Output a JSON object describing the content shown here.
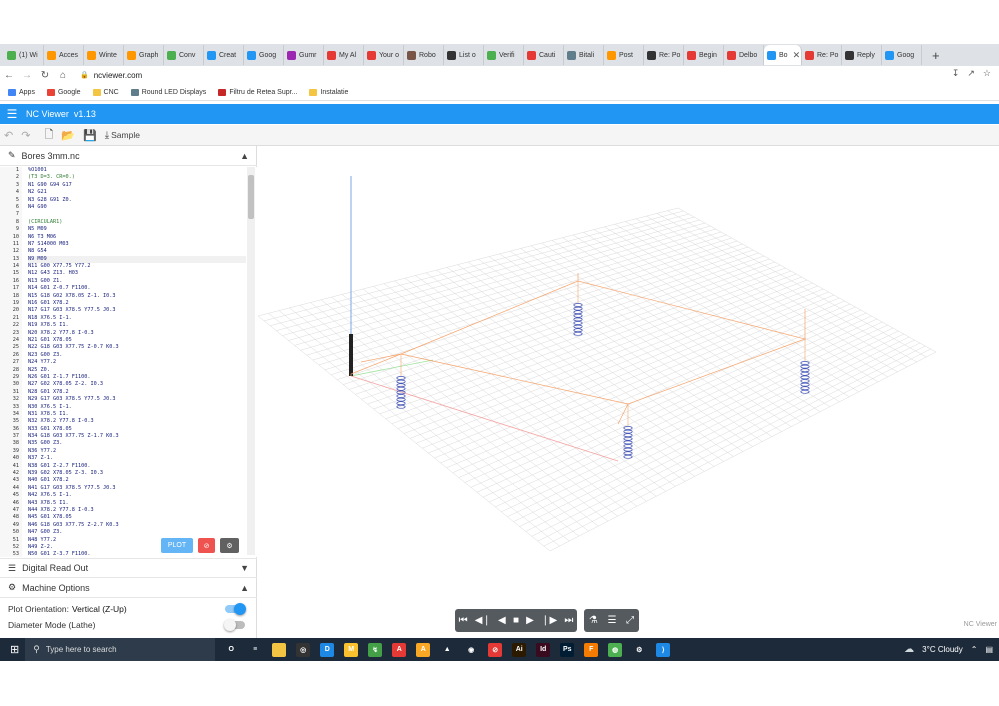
{
  "browser": {
    "tabs": [
      {
        "label": "(1) Wi",
        "color": "#4caf50"
      },
      {
        "label": "Acces",
        "color": "#ff9800"
      },
      {
        "label": "Winte",
        "color": "#ff9800"
      },
      {
        "label": "Graph",
        "color": "#ff9800"
      },
      {
        "label": "Conv",
        "color": "#4caf50"
      },
      {
        "label": "Creat",
        "color": "#2196f3"
      },
      {
        "label": "Goog",
        "color": "#2196f3"
      },
      {
        "label": "Gumr",
        "color": "#9c27b0"
      },
      {
        "label": "My Al",
        "color": "#e53935"
      },
      {
        "label": "Your o",
        "color": "#e53935"
      },
      {
        "label": "Robo",
        "color": "#795548"
      },
      {
        "label": "List o",
        "color": "#333333"
      },
      {
        "label": "Verifi",
        "color": "#4caf50"
      },
      {
        "label": "Cauti",
        "color": "#e53935"
      },
      {
        "label": "Bitali",
        "color": "#607d8b"
      },
      {
        "label": "Post",
        "color": "#ff9800"
      },
      {
        "label": "Re: Po",
        "color": "#333333"
      },
      {
        "label": "Begin",
        "color": "#e53935"
      },
      {
        "label": "Delbo",
        "color": "#e53935"
      },
      {
        "label": "Bo",
        "color": "#2196f3"
      },
      {
        "label": "Re: Po",
        "color": "#e53935"
      },
      {
        "label": "Reply",
        "color": "#333333"
      },
      {
        "label": "Goog",
        "color": "#2196f3"
      }
    ],
    "active_tab_index": 19,
    "url": "ncviewer.com",
    "bookmarks": [
      {
        "label": "Apps",
        "color": "#4285f4"
      },
      {
        "label": "Google",
        "color": "#ea4335"
      },
      {
        "label": "CNC",
        "color": "#f4c542"
      },
      {
        "label": "Round LED Displays",
        "color": "#607d8b"
      },
      {
        "label": "Filtru de Retea Supr...",
        "color": "#c62828"
      },
      {
        "label": "Instalatie",
        "color": "#f4c542"
      }
    ]
  },
  "app": {
    "title": "NC Viewer",
    "version": "v1.13",
    "header_color": "#2196f3",
    "toolbar": {
      "undo_icon": "undo-icon",
      "redo_icon": "redo-icon",
      "new_icon": "new-file-icon",
      "open_icon": "folder-open-icon",
      "save_icon": "save-icon",
      "sample_label": "Sample"
    }
  },
  "editor": {
    "filename": "Bores 3mm.nc",
    "current_line": 13,
    "lines": [
      "%O1001",
      "(T3 D=3. CR=0.)",
      "N1 G90 G94 G17",
      "N2 G21",
      "N3 G28 G91 Z0.",
      "N4 G90",
      "",
      "(CIRCULAR1)",
      "N5 M09",
      "N6 T3 M06",
      "N7 S14000 M03",
      "N8 G54",
      "N9 M09",
      "N11 G00 X77.75 Y77.2",
      "N12 G43 Z13. H03",
      "N13 G00 Z1.",
      "N14 G01 Z-0.7 F1100.",
      "N15 G18 G02 X78.05 Z-1. I0.3",
      "N16 G01 X78.2",
      "N17 G17 G03 X78.5 Y77.5 J0.3",
      "N18 X76.5 I-1.",
      "N19 X78.5 I1.",
      "N20 X78.2 Y77.8 I-0.3",
      "N21 G01 X78.05",
      "N22 G18 G03 X77.75 Z-0.7 K0.3",
      "N23 G00 Z3.",
      "N24 Y77.2",
      "N25 Z0.",
      "N26 G01 Z-1.7 F1100.",
      "N27 G02 X78.05 Z-2. I0.3",
      "N28 G01 X78.2",
      "N29 G17 G03 X78.5 Y77.5 J0.3",
      "N30 X76.5 I-1.",
      "N31 X78.5 I1.",
      "N32 X78.2 Y77.8 I-0.3",
      "N33 G01 X78.05",
      "N34 G18 G03 X77.75 Z-1.7 K0.3",
      "N35 G00 Z3.",
      "N36 Y77.2",
      "N37 Z-1.",
      "N38 G01 Z-2.7 F1100.",
      "N39 G02 X78.05 Z-3. I0.3",
      "N40 G01 X78.2",
      "N41 G17 G03 X78.5 Y77.5 J0.3",
      "N42 X76.5 I-1.",
      "N43 X78.5 I1.",
      "N44 X78.2 Y77.8 I-0.3",
      "N45 G01 X78.05",
      "N46 G18 G03 X77.75 Z-2.7 K0.3",
      "N47 G00 Z3.",
      "N48 Y77.2",
      "N49 Z-2.",
      "N50 G01 Z-3.7 F1100."
    ],
    "plot_label": "PLOT"
  },
  "panels": {
    "dro_title": "Digital Read Out",
    "machine_title": "Machine Options",
    "plot_orientation_label": "Plot Orientation:",
    "plot_orientation_value": "Vertical (Z-Up)",
    "plot_orientation_on": true,
    "diameter_mode_label": "Diameter Mode (Lathe)",
    "diameter_mode_on": false
  },
  "viewport": {
    "watermark": "NC Viewer"
  },
  "taskbar": {
    "search_placeholder": "Type here to search",
    "weather": "3°C  Cloudy",
    "apps": [
      {
        "name": "task-view-icon",
        "glyph": "O",
        "color": "transparent"
      },
      {
        "name": "widgets-icon",
        "glyph": "≡",
        "color": "transparent"
      },
      {
        "name": "file-explorer-icon",
        "glyph": "",
        "color": "#f4c542"
      },
      {
        "name": "app-icon-1",
        "glyph": "◎",
        "color": "#333333"
      },
      {
        "name": "app-icon-2",
        "glyph": "D",
        "color": "#1e88e5"
      },
      {
        "name": "app-icon-3",
        "glyph": "M",
        "color": "#fbc02d"
      },
      {
        "name": "app-icon-4",
        "glyph": "↯",
        "color": "#43a047"
      },
      {
        "name": "app-icon-5",
        "glyph": "A",
        "color": "#e53935"
      },
      {
        "name": "app-icon-6",
        "glyph": "A",
        "color": "#f9a825"
      },
      {
        "name": "app-icon-7",
        "glyph": "▲",
        "color": "#1c2a3a"
      },
      {
        "name": "app-icon-8",
        "glyph": "◉",
        "color": "#1c2a3a"
      },
      {
        "name": "app-icon-9",
        "glyph": "⊘",
        "color": "#e53935"
      },
      {
        "name": "illustrator-icon",
        "glyph": "Ai",
        "color": "#2b1a00"
      },
      {
        "name": "indesign-icon",
        "glyph": "Id",
        "color": "#3a0a1f"
      },
      {
        "name": "photoshop-icon",
        "glyph": "Ps",
        "color": "#001d34"
      },
      {
        "name": "app-icon-10",
        "glyph": "F",
        "color": "#f57c00"
      },
      {
        "name": "chrome-icon",
        "glyph": "◍",
        "color": "#4caf50"
      },
      {
        "name": "settings-icon",
        "glyph": "⚙",
        "color": "transparent"
      },
      {
        "name": "vscode-icon",
        "glyph": "⟩",
        "color": "#1e88e5"
      }
    ]
  }
}
